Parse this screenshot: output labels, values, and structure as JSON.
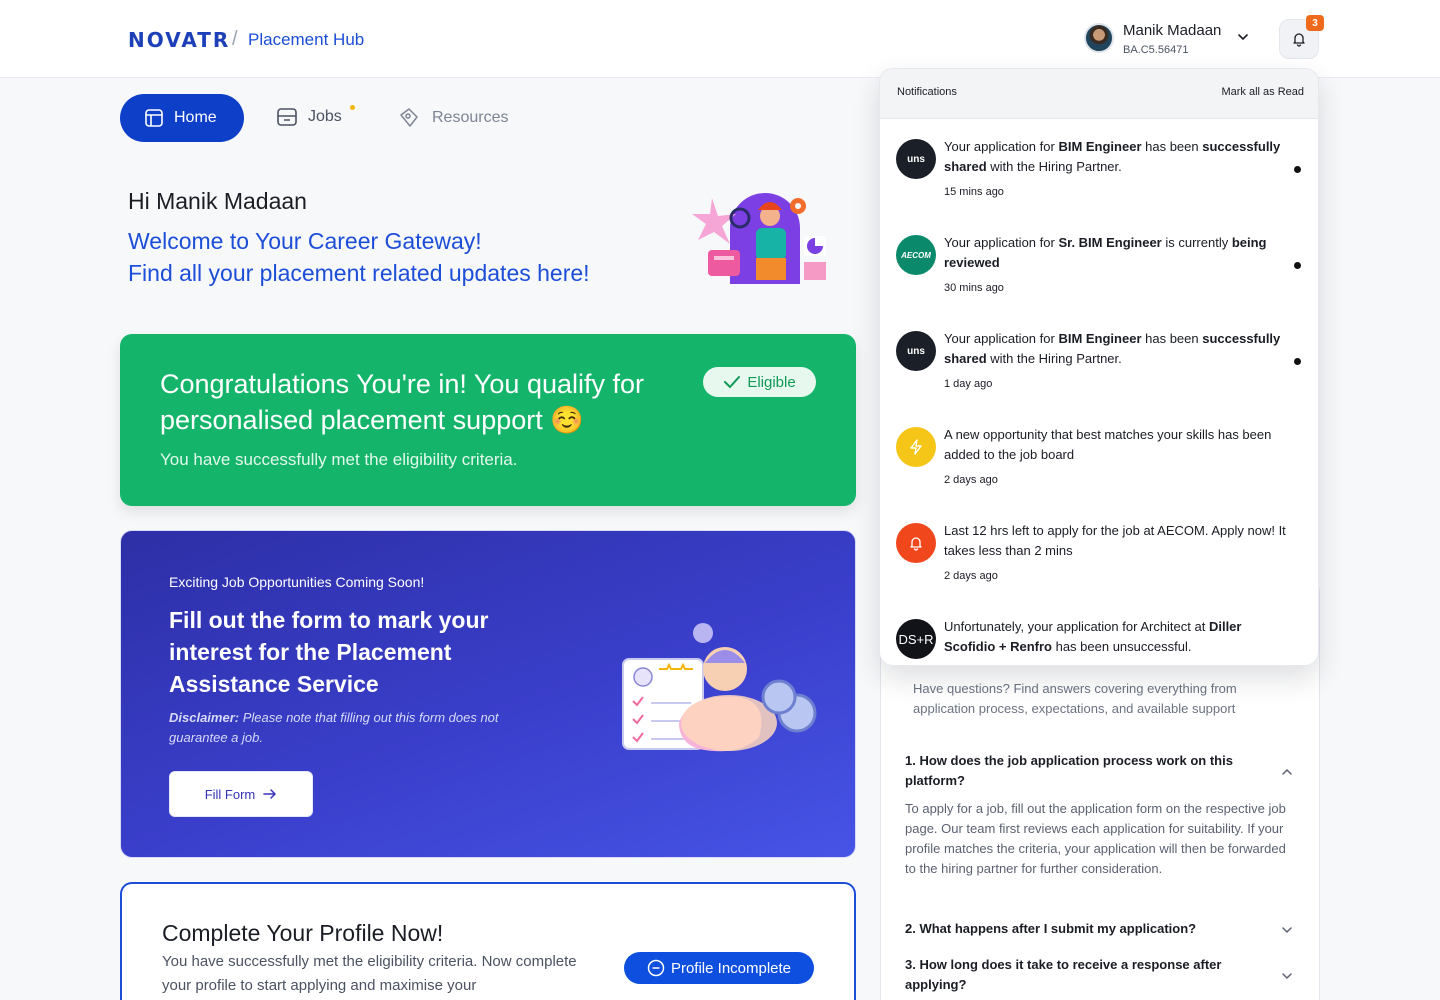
{
  "header": {
    "logo": "NOVATR",
    "separator": "/",
    "product": "Placement Hub",
    "user_name": "Manik Madaan",
    "user_id": "BA.C5.56471",
    "notification_count": "3"
  },
  "nav": {
    "home": "Home",
    "jobs": "Jobs",
    "resources": "Resources"
  },
  "welcome": {
    "greeting": "Hi Manik Madaan",
    "line1": "Welcome to Your Career Gateway!",
    "line2": "Find all your placement related updates here!"
  },
  "eligibility_card": {
    "title": "Congratulations You're in! You qualify for personalised placement support ☺️",
    "subtitle": "You have successfully met the eligibility criteria.",
    "badge": "Eligible"
  },
  "opportunities_card": {
    "overline": "Exciting Job Opportunities Coming Soon!",
    "title": "Fill out the form to mark your interest for the Placement Assistance Service",
    "disclaimer_label": "Disclaimer:",
    "disclaimer_text": " Please note that filling out this form does not guarantee a job.",
    "button": "Fill Form"
  },
  "profile_card": {
    "title": "Complete Your Profile Now!",
    "subtitle": "You have successfully met the eligibility criteria. Now complete your profile to start applying and maximise your",
    "badge": "Profile Incomplete"
  },
  "faq": {
    "intro": "Have questions? Find answers covering everything from application process, expectations, and available support",
    "items": [
      {
        "question": "1. How does the job application process work on this platform?",
        "answer": "To apply for a job, fill out the application form on the respective job page. Our team first reviews each application for suitability. If your profile matches the criteria, your application will then be forwarded to the hiring partner for further consideration."
      },
      {
        "question": "2. What happens after I submit my application?"
      },
      {
        "question": "3. How long does it take to receive a response after applying?"
      }
    ]
  },
  "notifications": {
    "title": "Notifications",
    "mark_all": "Mark all as Read",
    "items": [
      {
        "avatar": "uns",
        "avatar_color": "#1b1f27",
        "pre": "Your application for ",
        "b1": "BIM Engineer",
        "mid": " has been ",
        "b2": "successfully shared",
        "post": " with the Hiring Partner.",
        "time": "15 mins ago",
        "unread": true
      },
      {
        "avatar": "AECOM",
        "avatar_color": "#0a8a6a",
        "pre": "Your application for ",
        "b1": "Sr. BIM Engineer",
        "mid": " is currently ",
        "b2": "being reviewed",
        "post": "",
        "time": "30 mins ago",
        "unread": true
      },
      {
        "avatar": "uns",
        "avatar_color": "#1b1f27",
        "pre": "Your application for ",
        "b1": "BIM Engineer",
        "mid": " has been ",
        "b2": "successfully shared",
        "post": " with the Hiring Partner.",
        "time": "1 day ago",
        "unread": true
      },
      {
        "avatar": "bolt-icon",
        "avatar_color": "#f5c518",
        "pre": "A new opportunity that best matches your skills has been added to the job board",
        "b1": "",
        "mid": "",
        "b2": "",
        "post": "",
        "time": "2 days ago",
        "unread": false
      },
      {
        "avatar": "bell-icon",
        "avatar_color": "#f0481c",
        "pre": "Last 12 hrs left to apply for the job at AECOM. Apply now! It takes less than 2 mins",
        "b1": "",
        "mid": "",
        "b2": "",
        "post": "",
        "time": "2 days ago",
        "unread": false
      },
      {
        "avatar": "DS+R",
        "avatar_color": "#111318",
        "pre": "Unfortunately, your application for Architect at ",
        "b1": "Diller Scofidio + Renfro",
        "mid": " has been unsuccessful.",
        "b2": "",
        "post": "",
        "time": "",
        "unread": false
      }
    ]
  },
  "colors": {
    "brand_blue": "#0e3fc9",
    "success_green": "#14b56a",
    "purple_card": "#3a3fcb",
    "badge_orange": "#f06a1c"
  }
}
